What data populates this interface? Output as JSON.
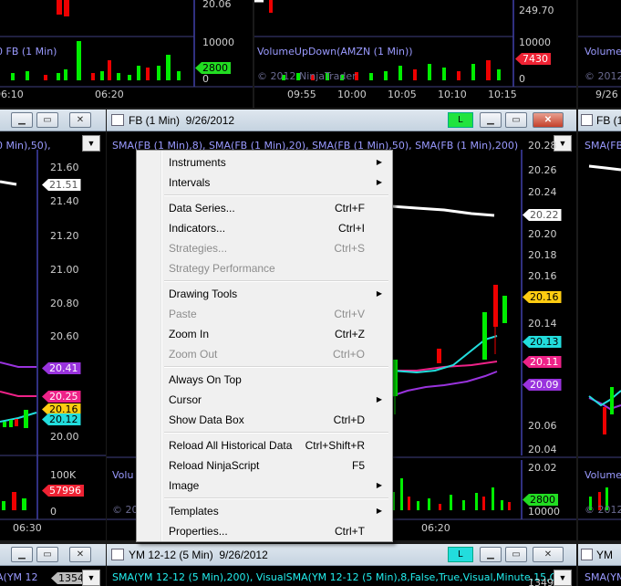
{
  "top_left": {
    "axis_labels": [
      "20.06",
      "10000",
      "0"
    ],
    "series_label": "0 FB (1 Min)",
    "volume_tag": "2800",
    "time_labels": [
      "06:10",
      "06:20"
    ]
  },
  "top_mid": {
    "axis_labels": [
      "249.70",
      "10000",
      "0"
    ],
    "series_label": "VolumeUpDown(AMZN (1 Min))",
    "watermark": "© 2012 NinjaTrader",
    "volume_tag": "7430",
    "time_labels": [
      "09:55",
      "10:00",
      "10:05",
      "10:10",
      "10:15"
    ]
  },
  "top_right": {
    "series_label": "Volume",
    "watermark": "© 2012",
    "time_label": "9/26"
  },
  "left_window": {
    "indicator_label": "0 Min),50),",
    "axis_labels": [
      "21.60",
      "21.40",
      "21.20",
      "21.00",
      "20.80",
      "20.60",
      "20.40",
      "20.20",
      "20.00",
      "100K",
      "0"
    ],
    "tags": {
      "white": "21.51",
      "purple": "20.41",
      "magenta": "20.25",
      "yellow": "20.16",
      "cyan": "20.12",
      "red": "57996"
    },
    "time_label": "06:30"
  },
  "main_window": {
    "title": "FB (1 Min)  9/26/2012",
    "indicator_label": "SMA(FB (1 Min),8), SMA(FB (1 Min),20), SMA(FB (1 Min),50), SMA(FB (1 Min),200)",
    "axis_labels": [
      "20.28",
      "20.26",
      "20.24",
      "20.22",
      "20.20",
      "20.18",
      "20.16",
      "20.14",
      "20.12",
      "20.10",
      "20.08",
      "20.06",
      "20.04",
      "20.02",
      "10000",
      "0"
    ],
    "tags": {
      "white": "20.22",
      "yellow": "20.16",
      "cyan": "20.13",
      "magenta": "20.11",
      "purple": "20.09",
      "green": "2800"
    },
    "volume_label": "Volu",
    "watermark": "© 20",
    "time_label": "06:20",
    "link_button": "L"
  },
  "right_window": {
    "title": "FB (1 Min",
    "indicator_label": "SMA(FB (1",
    "volume_label": "VolumeU",
    "watermark": "© 2012 N"
  },
  "bottom_window": {
    "title": "YM 12-12 (5 Min)  9/26/2012",
    "indicator_label": "SMA(YM 12-12 (5 Min),200), VisualSMA(YM 12-12 (5 Min),8,False,True,Visual,Minute,15,Ci",
    "axis_partial": "13490",
    "link_button": "L"
  },
  "bottom_left": {
    "indicator_label": "A(YM 12",
    "tag": "13540"
  },
  "bottom_right": {
    "title": "YM",
    "indicator_label": "SMA(YM"
  },
  "context_menu": {
    "items": [
      {
        "label": "Instruments",
        "shortcut": "",
        "submenu": true,
        "disabled": false
      },
      {
        "label": "Intervals",
        "shortcut": "",
        "submenu": true,
        "disabled": false
      },
      {
        "label": "Data Series...",
        "shortcut": "Ctrl+F",
        "submenu": false,
        "disabled": false
      },
      {
        "label": "Indicators...",
        "shortcut": "Ctrl+I",
        "submenu": false,
        "disabled": false
      },
      {
        "label": "Strategies...",
        "shortcut": "Ctrl+S",
        "submenu": false,
        "disabled": true
      },
      {
        "label": "Strategy Performance",
        "shortcut": "",
        "submenu": false,
        "disabled": true
      },
      {
        "label": "Drawing Tools",
        "shortcut": "",
        "submenu": true,
        "disabled": false
      },
      {
        "label": "Paste",
        "shortcut": "Ctrl+V",
        "submenu": false,
        "disabled": true
      },
      {
        "label": "Zoom In",
        "shortcut": "Ctrl+Z",
        "submenu": false,
        "disabled": false
      },
      {
        "label": "Zoom Out",
        "shortcut": "Ctrl+O",
        "submenu": false,
        "disabled": true
      },
      {
        "label": "Always On Top",
        "shortcut": "",
        "submenu": false,
        "disabled": false
      },
      {
        "label": "Cursor",
        "shortcut": "",
        "submenu": true,
        "disabled": false
      },
      {
        "label": "Show Data Box",
        "shortcut": "Ctrl+D",
        "submenu": false,
        "disabled": false
      },
      {
        "label": "Reload All Historical Data",
        "shortcut": "Ctrl+Shift+R",
        "submenu": false,
        "disabled": false
      },
      {
        "label": "Reload NinjaScript",
        "shortcut": "F5",
        "submenu": false,
        "disabled": false
      },
      {
        "label": "Image",
        "shortcut": "",
        "submenu": true,
        "disabled": false
      },
      {
        "label": "Templates",
        "shortcut": "",
        "submenu": true,
        "disabled": false
      },
      {
        "label": "Properties...",
        "shortcut": "Ctrl+T",
        "submenu": false,
        "disabled": false
      }
    ]
  },
  "colors": {
    "axis_line": "#6060ff",
    "up_bar": "#00ee00",
    "down_bar": "#ee0000",
    "sma_white": "#ffffff",
    "sma_cyan": "#22dddd",
    "sma_magenta": "#ee2288",
    "sma_purple": "#9933dd"
  }
}
